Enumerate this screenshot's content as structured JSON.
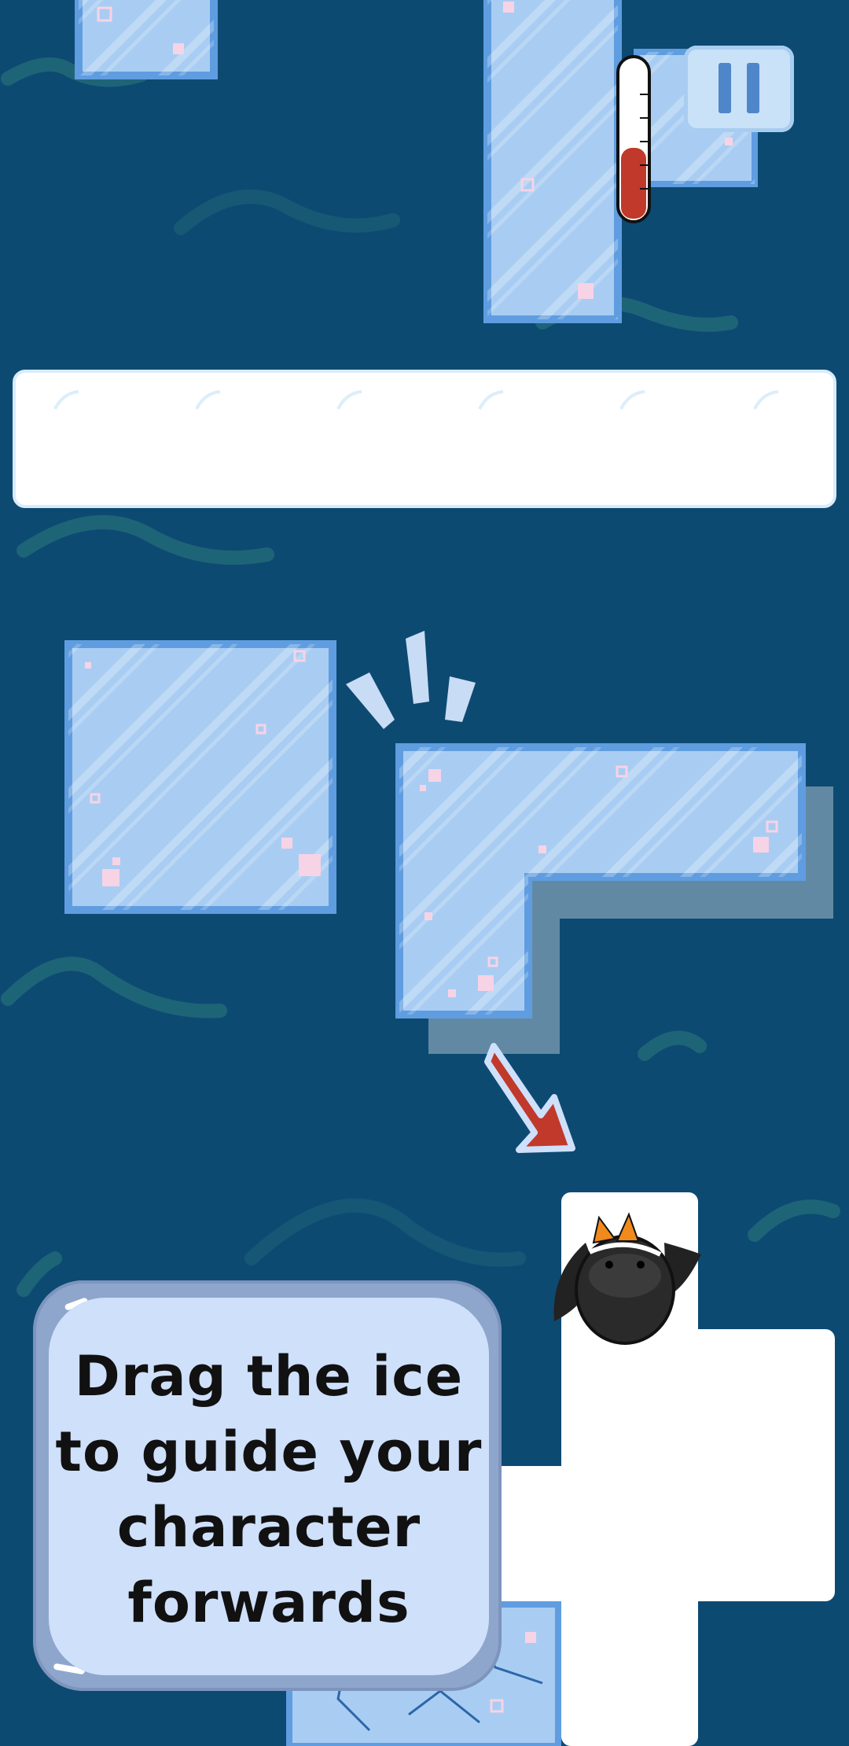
{
  "tutorial": {
    "line1": "Drag the ice",
    "line2": "to guide your",
    "line3": "character",
    "line4": "forwards"
  },
  "thermometer": {
    "fill_fraction": 0.45,
    "color": "#c0392b"
  },
  "colors": {
    "water": "#0d4a72",
    "wave": "#1f6b7a",
    "ice": "#a9cdf2",
    "ice_border": "#5f9de0",
    "snow": "#ffffff",
    "arrow": "#c0392b"
  },
  "icons": [
    "pause-icon",
    "thermometer-icon",
    "drag-hint-arrow-icon",
    "penguin-icon",
    "impact-lines-icon"
  ]
}
